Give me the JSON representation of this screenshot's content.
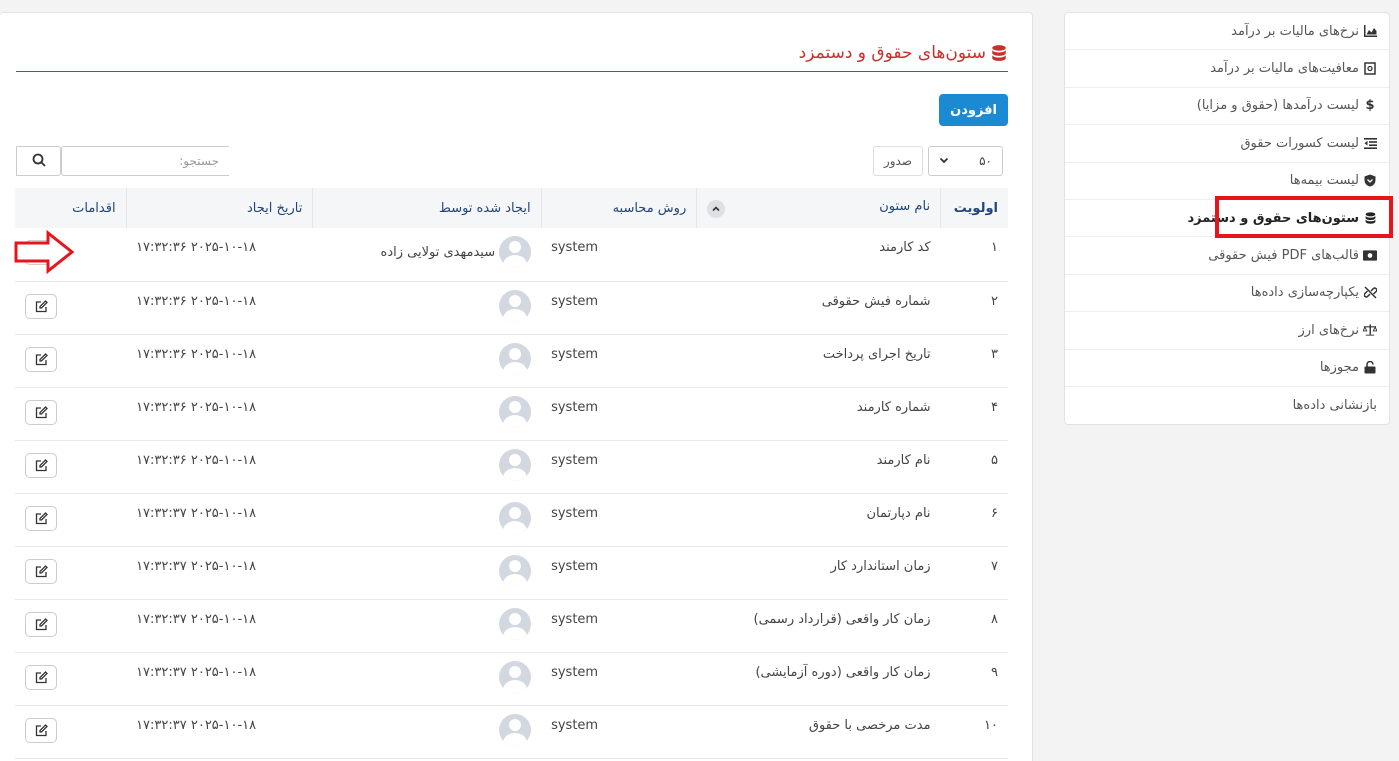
{
  "sidebar": {
    "items": [
      {
        "label": "نرخ‌های مالیات بر درآمد",
        "icon": "chart-area-icon",
        "active": false
      },
      {
        "label": "معافیت‌های مالیات بر درآمد",
        "icon": "receipt-icon",
        "active": false
      },
      {
        "label": "لیست درآمدها (حقوق و مزایا)",
        "icon": "dollar-icon",
        "active": false
      },
      {
        "label": "لیست کسورات حقوق",
        "icon": "outdent-icon",
        "active": false
      },
      {
        "label": "لیست بیمه‌ها",
        "icon": "shield-icon",
        "active": false
      },
      {
        "label": "ستون‌های حقوق و دستمزد",
        "icon": "database-icon",
        "active": true
      },
      {
        "label": "قالب‌های PDF فیش حقوقی",
        "icon": "money-bill-icon",
        "active": false
      },
      {
        "label": "یکپارچه‌سازی داده‌ها",
        "icon": "unlink-icon",
        "active": false
      },
      {
        "label": "نرخ‌های ارز",
        "icon": "balance-scale-icon",
        "active": false
      },
      {
        "label": "مجوزها",
        "icon": "unlock-icon",
        "active": false
      },
      {
        "label": "بازنشانی داده‌ها",
        "icon": "",
        "active": false
      }
    ]
  },
  "page": {
    "title": "ستون‌های حقوق و دستمزد",
    "add_label": "افزودن"
  },
  "table_controls": {
    "length_value": "۵۰",
    "length_label": "صدور",
    "search_placeholder": "جستجو:"
  },
  "table": {
    "headers": {
      "priority": "اولویت",
      "name": "نام ستون",
      "calc": "روش محاسبه",
      "created_by": "ایجاد شده توسط",
      "created_at": "تاریخ ایجاد",
      "actions": "اقدامات"
    },
    "rows": [
      {
        "priority": "۱",
        "name": "کد کارمند",
        "calc": "system",
        "created_by": "سیدمهدی تولایی زاده",
        "created_at": "۲۰۲۵-۱۰-۱۸ ۱۷:۳۲:۳۶"
      },
      {
        "priority": "۲",
        "name": "شماره فیش حقوقی",
        "calc": "system",
        "created_by": "",
        "created_at": "۲۰۲۵-۱۰-۱۸ ۱۷:۳۲:۳۶"
      },
      {
        "priority": "۳",
        "name": "تاریخ اجرای پرداخت",
        "calc": "system",
        "created_by": "",
        "created_at": "۲۰۲۵-۱۰-۱۸ ۱۷:۳۲:۳۶"
      },
      {
        "priority": "۴",
        "name": "شماره کارمند",
        "calc": "system",
        "created_by": "",
        "created_at": "۲۰۲۵-۱۰-۱۸ ۱۷:۳۲:۳۶"
      },
      {
        "priority": "۵",
        "name": "نام کارمند",
        "calc": "system",
        "created_by": "",
        "created_at": "۲۰۲۵-۱۰-۱۸ ۱۷:۳۲:۳۶"
      },
      {
        "priority": "۶",
        "name": "نام دپارتمان",
        "calc": "system",
        "created_by": "",
        "created_at": "۲۰۲۵-۱۰-۱۸ ۱۷:۳۲:۳۷"
      },
      {
        "priority": "۷",
        "name": "زمان استاندارد کار",
        "calc": "system",
        "created_by": "",
        "created_at": "۲۰۲۵-۱۰-۱۸ ۱۷:۳۲:۳۷"
      },
      {
        "priority": "۸",
        "name": "زمان کار واقعی (قرارداد رسمی)",
        "calc": "system",
        "created_by": "",
        "created_at": "۲۰۲۵-۱۰-۱۸ ۱۷:۳۲:۳۷"
      },
      {
        "priority": "۹",
        "name": "زمان کار واقعی (دوره آزمایشی)",
        "calc": "system",
        "created_by": "",
        "created_at": "۲۰۲۵-۱۰-۱۸ ۱۷:۳۲:۳۷"
      },
      {
        "priority": "۱۰",
        "name": "مدت مرخصی با حقوق",
        "calc": "system",
        "created_by": "",
        "created_at": "۲۰۲۵-۱۰-۱۸ ۱۷:۳۲:۳۷"
      }
    ]
  },
  "colors": {
    "accent_red": "#c9302c",
    "primary_blue": "#1a8bd3",
    "highlight_red": "#e8141c"
  }
}
